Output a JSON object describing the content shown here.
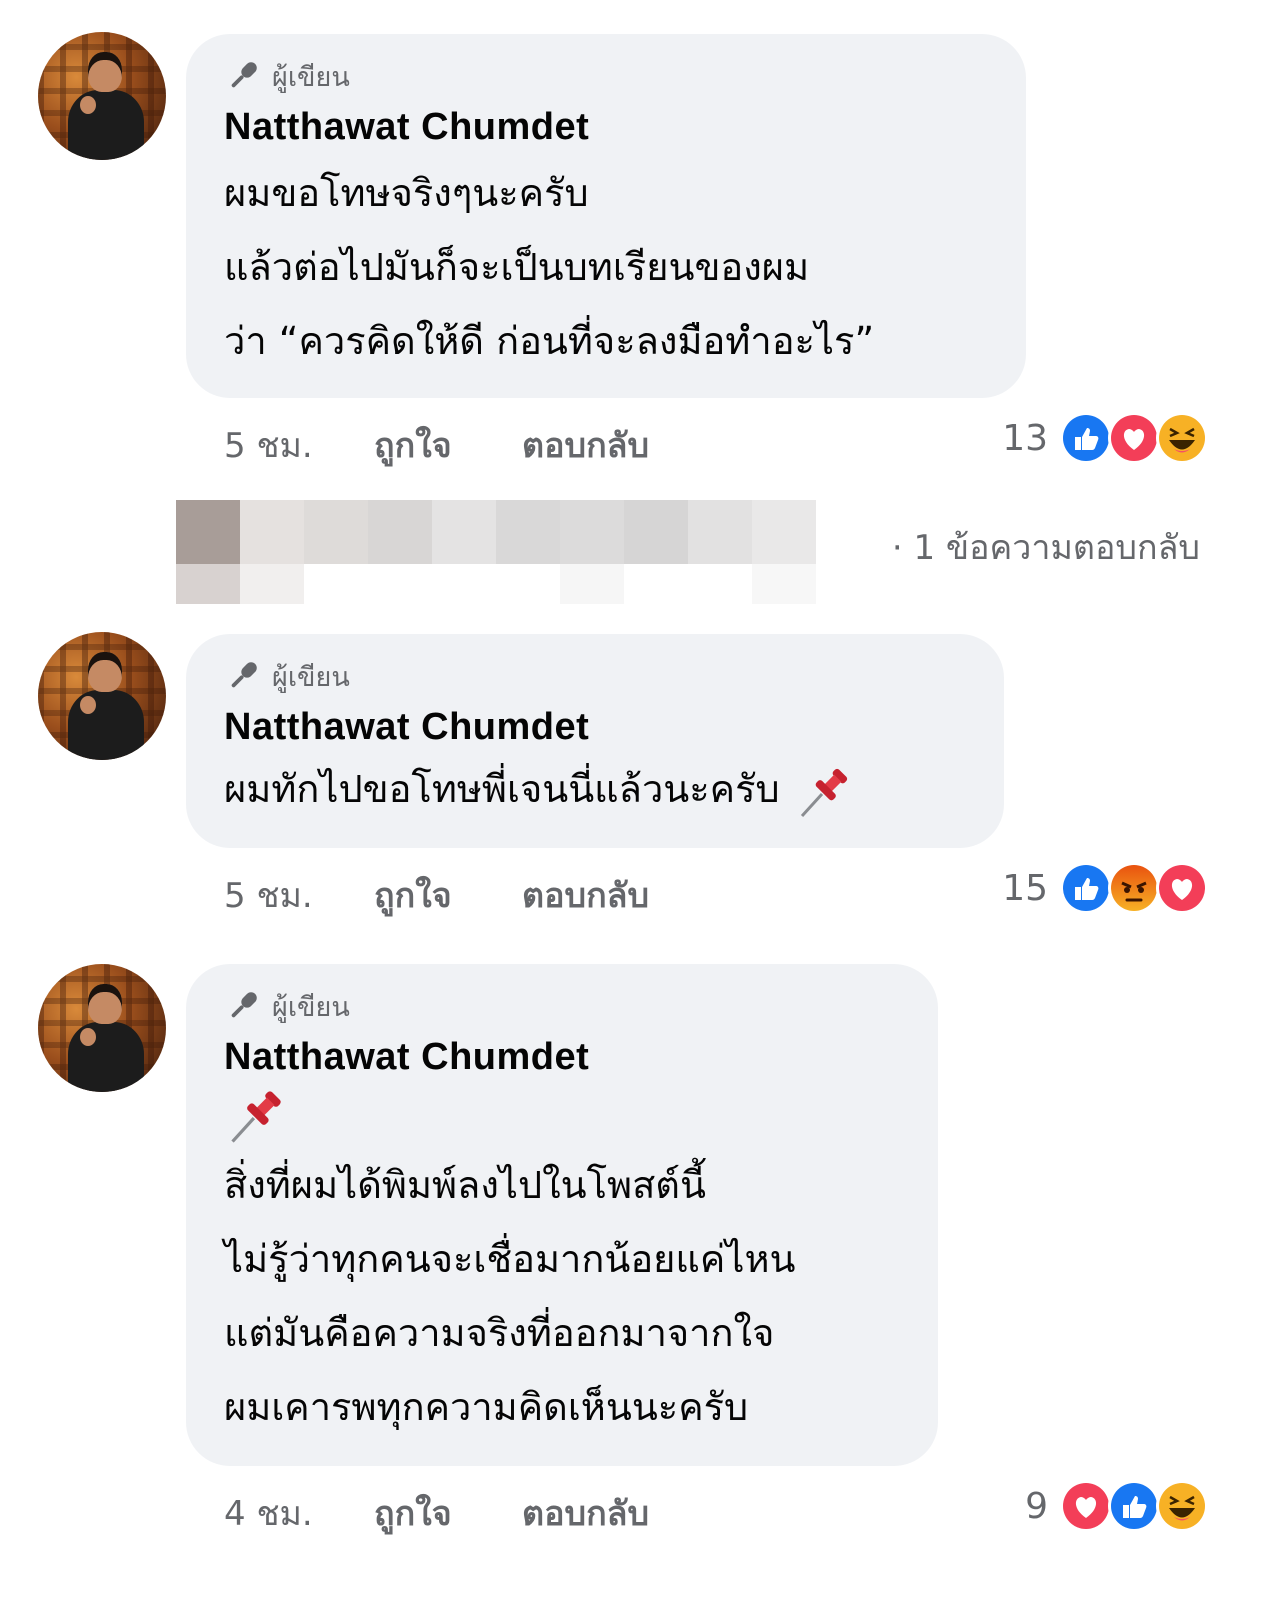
{
  "comments": [
    {
      "badge": "ผู้เขียน",
      "author": "Natthawat Chumdet",
      "lines": [
        "ผมขอโทษจริงๆนะครับ",
        "แล้วต่อไปมันก็จะเป็นบทเรียนของผม",
        "ว่า “ควรคิดให้ดี ก่อนที่จะลงมือทำอะไร”"
      ],
      "time": "5 ชม.",
      "like_label": "ถูกใจ",
      "reply_label": "ตอบกลับ",
      "reaction_count": "13",
      "reactions": [
        "like-icon",
        "love-icon",
        "haha-icon"
      ]
    },
    {
      "badge": "ผู้เขียน",
      "author": "Natthawat Chumdet",
      "lines": [
        "ผมทักไปขอโทษพี่เจนนี่แล้วนะครับ"
      ],
      "emoji": "pushpin-icon",
      "time": "5 ชม.",
      "like_label": "ถูกใจ",
      "reply_label": "ตอบกลับ",
      "reaction_count": "15",
      "reactions": [
        "like-icon",
        "angry-icon",
        "love-icon"
      ]
    },
    {
      "badge": "ผู้เขียน",
      "author": "Natthawat Chumdet",
      "emoji": "pushpin-icon",
      "lines": [
        "สิ่งที่ผมได้พิมพ์ลงไปในโพสต์นี้",
        "ไม่รู้ว่าทุกคนจะเชื่อมากน้อยแค่ไหน",
        "แต่มันคือความจริงที่ออกมาจากใจ",
        "ผมเคารพทุกความคิดเห็นนะครับ"
      ],
      "time": "4 ชม.",
      "like_label": "ถูกใจ",
      "reply_label": "ตอบกลับ",
      "reaction_count": "9",
      "reactions": [
        "love-icon",
        "like-icon",
        "haha-icon"
      ]
    }
  ],
  "reply_thread": {
    "count_text": "· 1 ข้อความตอบกลับ"
  },
  "colors": {
    "bubble": "#f0f2f5",
    "meta_text": "#65676b",
    "like_blue": "#1877f2",
    "love_red": "#f33e58",
    "haha_yellow": "#f7b125",
    "angry_orange": "#e9710f"
  }
}
